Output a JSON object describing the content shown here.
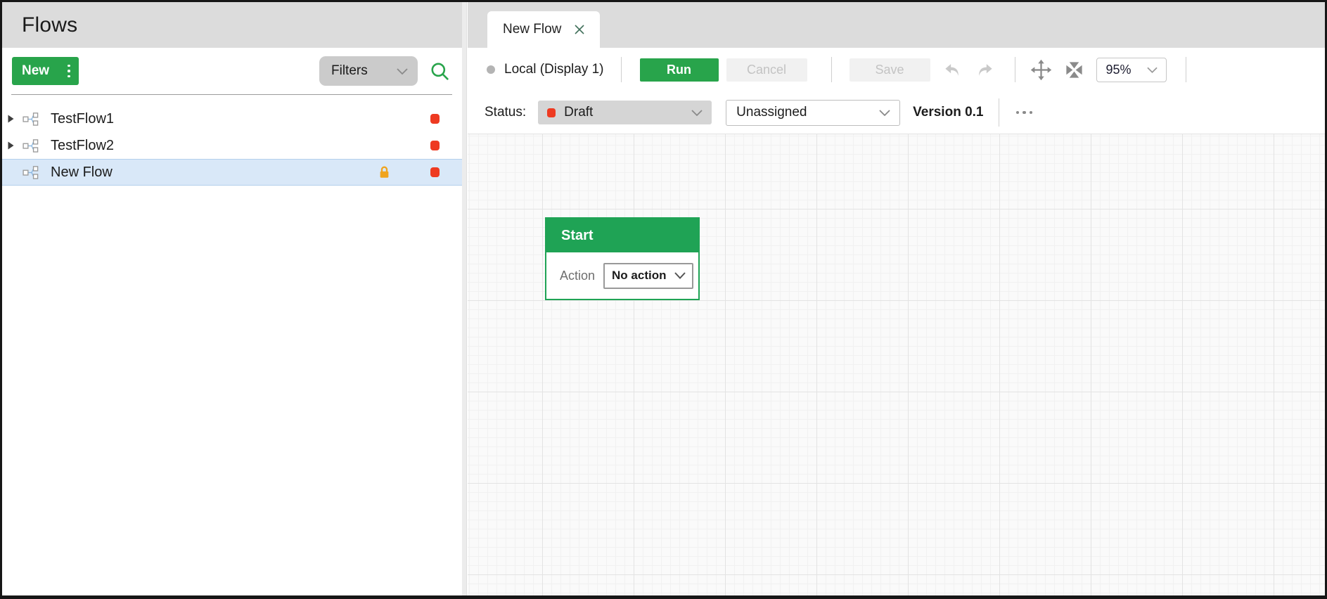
{
  "colors": {
    "accent_green": "#28a44b",
    "node_green": "#1fa355",
    "status_red": "#ee3a21",
    "lock_orange": "#f0a41e",
    "selected_row_bg": "#d9e8f8",
    "header_gray": "#dcdcdc"
  },
  "sidebar": {
    "title": "Flows",
    "new_button_label": "New",
    "filters_label": "Filters",
    "flows": [
      {
        "name": "TestFlow1",
        "expandable": true,
        "locked": false,
        "selected": false,
        "status_color": "#ee3a21"
      },
      {
        "name": "TestFlow2",
        "expandable": true,
        "locked": false,
        "selected": false,
        "status_color": "#ee3a21"
      },
      {
        "name": "New Flow",
        "expandable": false,
        "locked": true,
        "selected": true,
        "status_color": "#ee3a21"
      }
    ]
  },
  "tabs": [
    {
      "label": "New Flow"
    }
  ],
  "toolbar": {
    "target_label": "Local (Display 1)",
    "run_label": "Run",
    "cancel_label": "Cancel",
    "save_label": "Save",
    "zoom_level": "95%"
  },
  "status_bar": {
    "label": "Status:",
    "status_value": "Draft",
    "assignment_value": "Unassigned",
    "version": "Version 0.1"
  },
  "canvas": {
    "start_node": {
      "title": "Start",
      "action_label": "Action",
      "action_value": "No action"
    }
  }
}
